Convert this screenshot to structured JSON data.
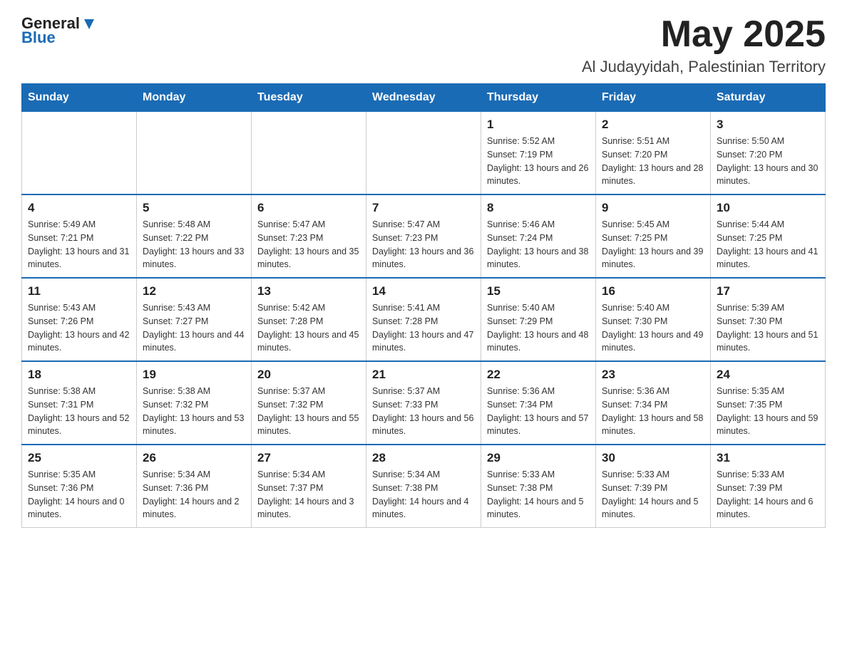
{
  "header": {
    "logo_general": "General",
    "logo_blue": "Blue",
    "month_title": "May 2025",
    "location": "Al Judayyidah, Palestinian Territory"
  },
  "days_of_week": [
    "Sunday",
    "Monday",
    "Tuesday",
    "Wednesday",
    "Thursday",
    "Friday",
    "Saturday"
  ],
  "weeks": [
    [
      {
        "day": "",
        "sunrise": "",
        "sunset": "",
        "daylight": ""
      },
      {
        "day": "",
        "sunrise": "",
        "sunset": "",
        "daylight": ""
      },
      {
        "day": "",
        "sunrise": "",
        "sunset": "",
        "daylight": ""
      },
      {
        "day": "",
        "sunrise": "",
        "sunset": "",
        "daylight": ""
      },
      {
        "day": "1",
        "sunrise": "Sunrise: 5:52 AM",
        "sunset": "Sunset: 7:19 PM",
        "daylight": "Daylight: 13 hours and 26 minutes."
      },
      {
        "day": "2",
        "sunrise": "Sunrise: 5:51 AM",
        "sunset": "Sunset: 7:20 PM",
        "daylight": "Daylight: 13 hours and 28 minutes."
      },
      {
        "day": "3",
        "sunrise": "Sunrise: 5:50 AM",
        "sunset": "Sunset: 7:20 PM",
        "daylight": "Daylight: 13 hours and 30 minutes."
      }
    ],
    [
      {
        "day": "4",
        "sunrise": "Sunrise: 5:49 AM",
        "sunset": "Sunset: 7:21 PM",
        "daylight": "Daylight: 13 hours and 31 minutes."
      },
      {
        "day": "5",
        "sunrise": "Sunrise: 5:48 AM",
        "sunset": "Sunset: 7:22 PM",
        "daylight": "Daylight: 13 hours and 33 minutes."
      },
      {
        "day": "6",
        "sunrise": "Sunrise: 5:47 AM",
        "sunset": "Sunset: 7:23 PM",
        "daylight": "Daylight: 13 hours and 35 minutes."
      },
      {
        "day": "7",
        "sunrise": "Sunrise: 5:47 AM",
        "sunset": "Sunset: 7:23 PM",
        "daylight": "Daylight: 13 hours and 36 minutes."
      },
      {
        "day": "8",
        "sunrise": "Sunrise: 5:46 AM",
        "sunset": "Sunset: 7:24 PM",
        "daylight": "Daylight: 13 hours and 38 minutes."
      },
      {
        "day": "9",
        "sunrise": "Sunrise: 5:45 AM",
        "sunset": "Sunset: 7:25 PM",
        "daylight": "Daylight: 13 hours and 39 minutes."
      },
      {
        "day": "10",
        "sunrise": "Sunrise: 5:44 AM",
        "sunset": "Sunset: 7:25 PM",
        "daylight": "Daylight: 13 hours and 41 minutes."
      }
    ],
    [
      {
        "day": "11",
        "sunrise": "Sunrise: 5:43 AM",
        "sunset": "Sunset: 7:26 PM",
        "daylight": "Daylight: 13 hours and 42 minutes."
      },
      {
        "day": "12",
        "sunrise": "Sunrise: 5:43 AM",
        "sunset": "Sunset: 7:27 PM",
        "daylight": "Daylight: 13 hours and 44 minutes."
      },
      {
        "day": "13",
        "sunrise": "Sunrise: 5:42 AM",
        "sunset": "Sunset: 7:28 PM",
        "daylight": "Daylight: 13 hours and 45 minutes."
      },
      {
        "day": "14",
        "sunrise": "Sunrise: 5:41 AM",
        "sunset": "Sunset: 7:28 PM",
        "daylight": "Daylight: 13 hours and 47 minutes."
      },
      {
        "day": "15",
        "sunrise": "Sunrise: 5:40 AM",
        "sunset": "Sunset: 7:29 PM",
        "daylight": "Daylight: 13 hours and 48 minutes."
      },
      {
        "day": "16",
        "sunrise": "Sunrise: 5:40 AM",
        "sunset": "Sunset: 7:30 PM",
        "daylight": "Daylight: 13 hours and 49 minutes."
      },
      {
        "day": "17",
        "sunrise": "Sunrise: 5:39 AM",
        "sunset": "Sunset: 7:30 PM",
        "daylight": "Daylight: 13 hours and 51 minutes."
      }
    ],
    [
      {
        "day": "18",
        "sunrise": "Sunrise: 5:38 AM",
        "sunset": "Sunset: 7:31 PM",
        "daylight": "Daylight: 13 hours and 52 minutes."
      },
      {
        "day": "19",
        "sunrise": "Sunrise: 5:38 AM",
        "sunset": "Sunset: 7:32 PM",
        "daylight": "Daylight: 13 hours and 53 minutes."
      },
      {
        "day": "20",
        "sunrise": "Sunrise: 5:37 AM",
        "sunset": "Sunset: 7:32 PM",
        "daylight": "Daylight: 13 hours and 55 minutes."
      },
      {
        "day": "21",
        "sunrise": "Sunrise: 5:37 AM",
        "sunset": "Sunset: 7:33 PM",
        "daylight": "Daylight: 13 hours and 56 minutes."
      },
      {
        "day": "22",
        "sunrise": "Sunrise: 5:36 AM",
        "sunset": "Sunset: 7:34 PM",
        "daylight": "Daylight: 13 hours and 57 minutes."
      },
      {
        "day": "23",
        "sunrise": "Sunrise: 5:36 AM",
        "sunset": "Sunset: 7:34 PM",
        "daylight": "Daylight: 13 hours and 58 minutes."
      },
      {
        "day": "24",
        "sunrise": "Sunrise: 5:35 AM",
        "sunset": "Sunset: 7:35 PM",
        "daylight": "Daylight: 13 hours and 59 minutes."
      }
    ],
    [
      {
        "day": "25",
        "sunrise": "Sunrise: 5:35 AM",
        "sunset": "Sunset: 7:36 PM",
        "daylight": "Daylight: 14 hours and 0 minutes."
      },
      {
        "day": "26",
        "sunrise": "Sunrise: 5:34 AM",
        "sunset": "Sunset: 7:36 PM",
        "daylight": "Daylight: 14 hours and 2 minutes."
      },
      {
        "day": "27",
        "sunrise": "Sunrise: 5:34 AM",
        "sunset": "Sunset: 7:37 PM",
        "daylight": "Daylight: 14 hours and 3 minutes."
      },
      {
        "day": "28",
        "sunrise": "Sunrise: 5:34 AM",
        "sunset": "Sunset: 7:38 PM",
        "daylight": "Daylight: 14 hours and 4 minutes."
      },
      {
        "day": "29",
        "sunrise": "Sunrise: 5:33 AM",
        "sunset": "Sunset: 7:38 PM",
        "daylight": "Daylight: 14 hours and 5 minutes."
      },
      {
        "day": "30",
        "sunrise": "Sunrise: 5:33 AM",
        "sunset": "Sunset: 7:39 PM",
        "daylight": "Daylight: 14 hours and 5 minutes."
      },
      {
        "day": "31",
        "sunrise": "Sunrise: 5:33 AM",
        "sunset": "Sunset: 7:39 PM",
        "daylight": "Daylight: 14 hours and 6 minutes."
      }
    ]
  ]
}
